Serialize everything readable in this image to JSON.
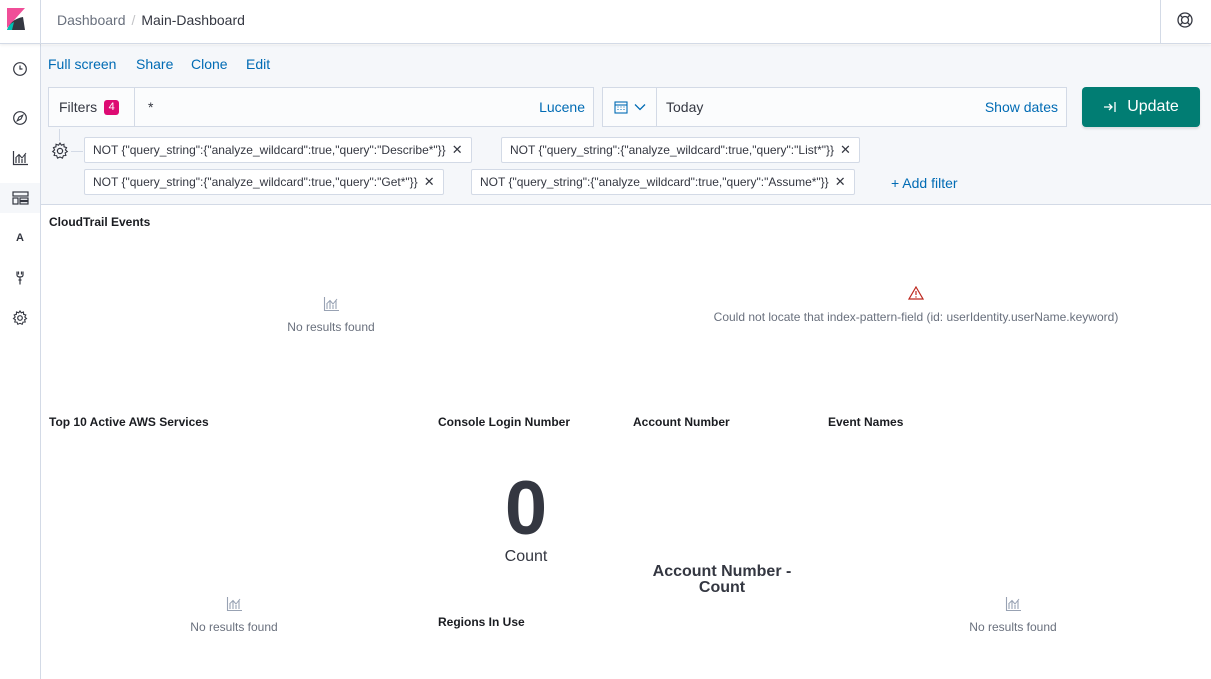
{
  "breadcrumbs": {
    "root": "Dashboard",
    "separator": "/",
    "current": "Main-Dashboard"
  },
  "header": {
    "logo": "kibana-logo-icon",
    "help": "help-lifebuoy-icon"
  },
  "sidenav": {
    "items": [
      {
        "icon": "clock-icon",
        "name": "recently-viewed"
      },
      {
        "icon": "compass-icon",
        "name": "discover"
      },
      {
        "icon": "visualize-icon",
        "name": "visualize"
      },
      {
        "icon": "dashboard-icon",
        "name": "dashboard",
        "active": true
      },
      {
        "icon": "letter-a-icon",
        "name": "timelion",
        "glyph": "A"
      },
      {
        "icon": "wrench-icon",
        "name": "dev-tools"
      },
      {
        "icon": "gear-icon",
        "name": "management"
      }
    ]
  },
  "menu": {
    "full_screen": "Full screen",
    "share": "Share",
    "clone": "Clone",
    "edit": "Edit"
  },
  "query": {
    "filters_label": "Filters",
    "filters_count": "4",
    "value": "*",
    "language": "Lucene"
  },
  "date": {
    "value": "Today",
    "show_dates": "Show dates"
  },
  "update_label": "Update",
  "filters": [
    "NOT {\"query_string\":{\"analyze_wildcard\":true,\"query\":\"Describe*\"}}",
    "NOT {\"query_string\":{\"analyze_wildcard\":true,\"query\":\"List*\"}}",
    "NOT {\"query_string\":{\"analyze_wildcard\":true,\"query\":\"Get*\"}}",
    "NOT {\"query_string\":{\"analyze_wildcard\":true,\"query\":\"Assume*\"}}"
  ],
  "add_filter": "+ Add filter",
  "panels": {
    "cloudtrail": {
      "title": "CloudTrail Events",
      "empty": "No results found"
    },
    "error": {
      "message": "Could not locate that index-pattern-field (id: userIdentity.userName.keyword)"
    },
    "top_services": {
      "title": "Top 10 Active AWS Services",
      "empty": "No results found"
    },
    "console_login": {
      "title": "Console Login Number",
      "value": "0",
      "label": "Count"
    },
    "account_number": {
      "title": "Account Number",
      "label": "Account Number -\nCount"
    },
    "event_names": {
      "title": "Event Names",
      "empty": "No results found"
    },
    "regions": {
      "title": "Regions In Use"
    }
  },
  "colors": {
    "accent": "#006bb4",
    "primary": "#017d73",
    "badge": "#dd0a73",
    "danger": "#bd271e"
  }
}
